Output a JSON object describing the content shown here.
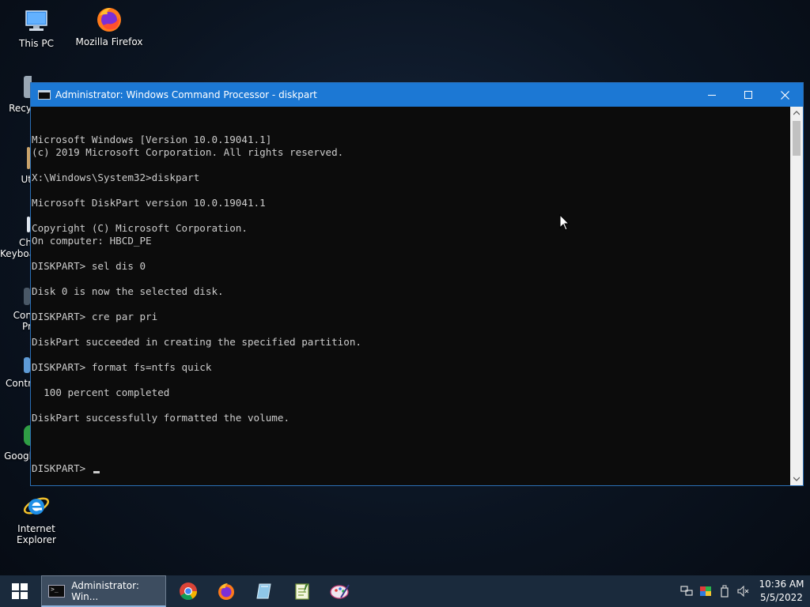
{
  "desktop": {
    "icons": [
      {
        "label": "This PC"
      },
      {
        "label": "Mozilla Firefox"
      },
      {
        "label": "Internet Explorer"
      }
    ],
    "partial_icons": [
      {
        "label": "Recy"
      },
      {
        "label": "Ut"
      },
      {
        "label": "Ch"
      },
      {
        "label": "Keyboa"
      },
      {
        "label": "Con"
      },
      {
        "label": "Pr"
      },
      {
        "label": "Contr"
      },
      {
        "label": "Googl"
      }
    ]
  },
  "window": {
    "title": "Administrator: Windows Command Processor - diskpart",
    "lines": [
      "Microsoft Windows [Version 10.0.19041.1]",
      "(c) 2019 Microsoft Corporation. All rights reserved.",
      "",
      "X:\\Windows\\System32>diskpart",
      "",
      "Microsoft DiskPart version 10.0.19041.1",
      "",
      "Copyright (C) Microsoft Corporation.",
      "On computer: HBCD_PE",
      "",
      "DISKPART> sel dis 0",
      "",
      "Disk 0 is now the selected disk.",
      "",
      "DISKPART> cre par pri",
      "",
      "DiskPart succeeded in creating the specified partition.",
      "",
      "DISKPART> format fs=ntfs quick",
      "",
      "  100 percent completed",
      "",
      "DiskPart successfully formatted the volume.",
      ""
    ],
    "prompt": "DISKPART> "
  },
  "taskbar": {
    "active_task_label": "Administrator: Win...",
    "clock_time": "10:36 AM",
    "clock_date": "5/5/2022"
  },
  "colors": {
    "titlebar": "#1c78d4",
    "console_bg": "#0c0c0c",
    "console_fg": "#cccccc",
    "taskbar": "#1a2a3c"
  }
}
